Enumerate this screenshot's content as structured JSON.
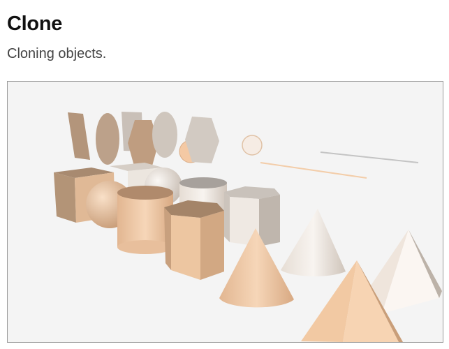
{
  "page": {
    "title": "Clone",
    "subtitle": "Cloning objects."
  },
  "scene": {
    "background": "#f4f4f4",
    "colors": {
      "peach": "#f0c9a4",
      "brown": "#b99a80",
      "light": "#ece4dc",
      "grey": "#c9c0b8"
    }
  }
}
